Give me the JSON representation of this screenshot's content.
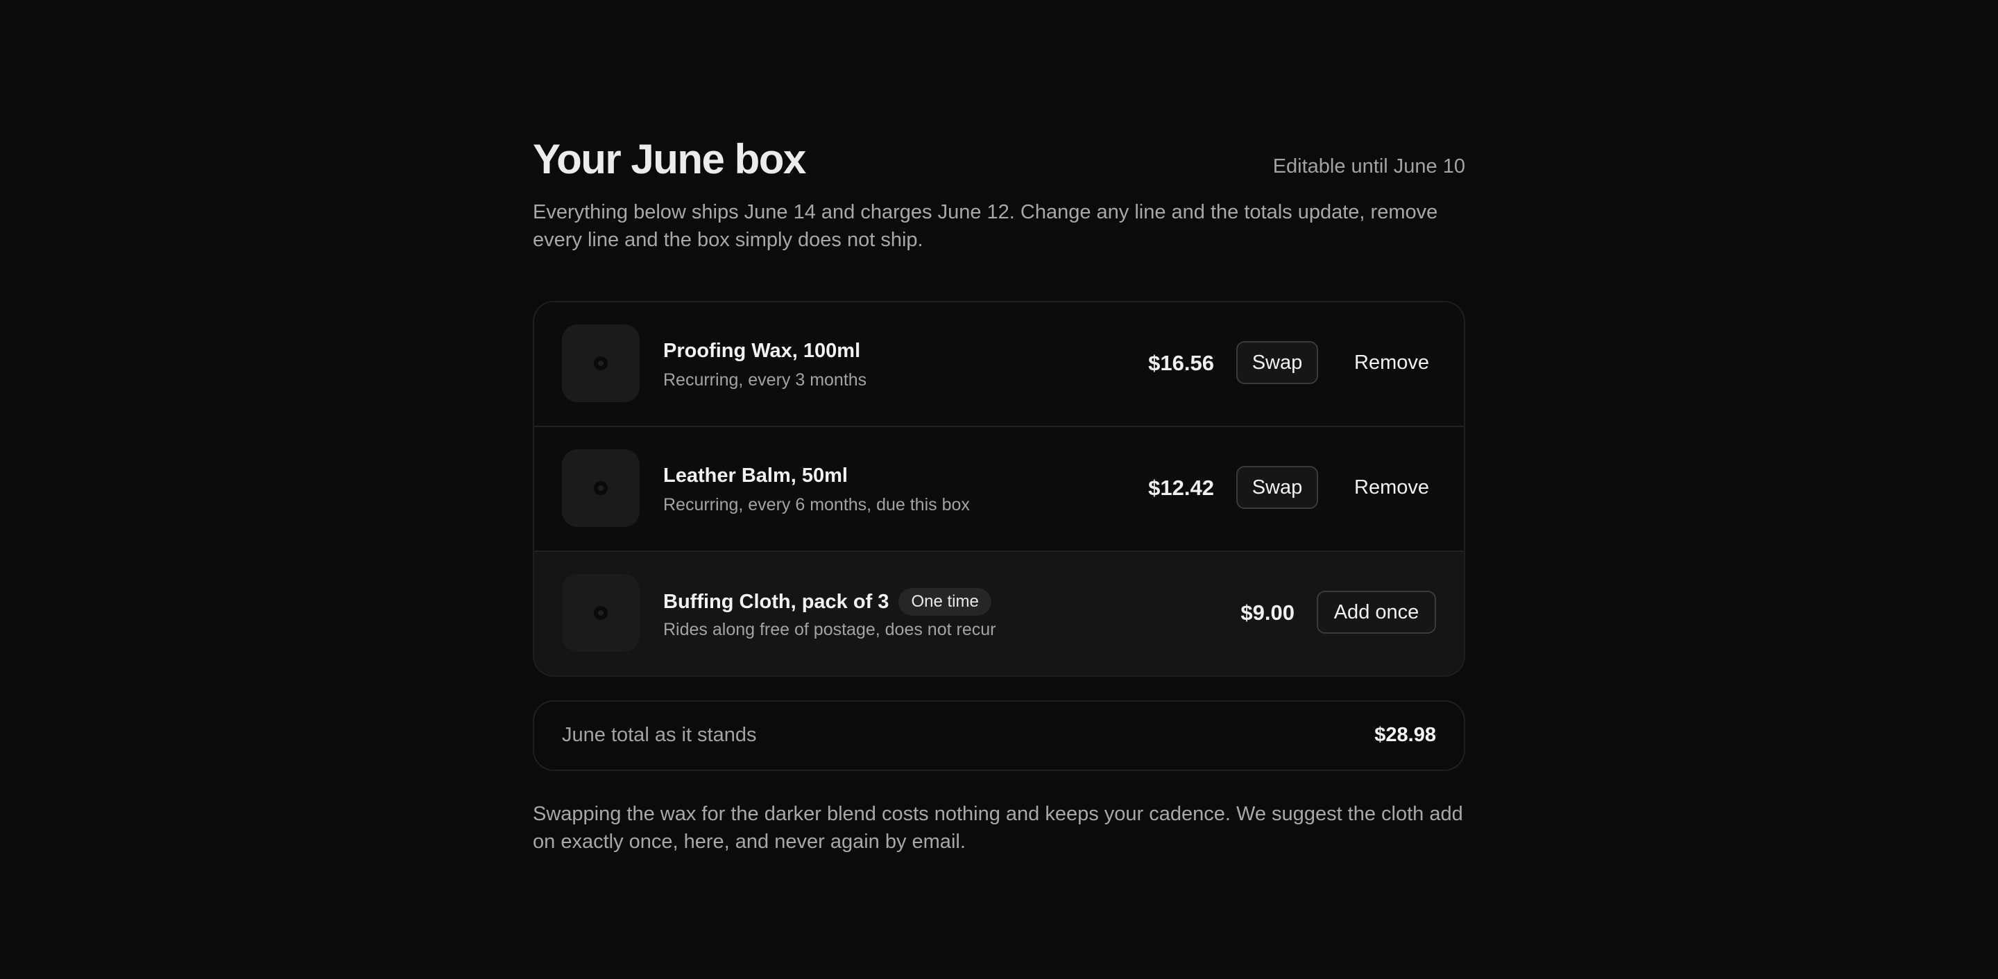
{
  "header": {
    "title": "Your June box",
    "editable_note": "Editable until June 10",
    "intro": "Everything below ships June 14 and charges June 12. Change any line and the totals update, remove every line and the box simply does not ship."
  },
  "items": [
    {
      "name": "Proofing Wax, 100ml",
      "subtitle": "Recurring, every 3 months",
      "price": "$16.56",
      "swap_label": "Swap",
      "remove_label": "Remove"
    },
    {
      "name": "Leather Balm, 50ml",
      "subtitle": "Recurring, every 6 months, due this box",
      "price": "$12.42",
      "swap_label": "Swap",
      "remove_label": "Remove"
    },
    {
      "name": "Buffing Cloth, pack of 3",
      "badge": "One time",
      "subtitle": "Rides along free of postage, does not recur",
      "price": "$9.00",
      "add_label": "Add once"
    }
  ],
  "totals": {
    "label": "June total as it stands",
    "value": "$28.98"
  },
  "footer": {
    "note": "Swapping the wax for the darker blend costs nothing and keeps your cadence. We suggest the cloth add on exactly once, here, and never again by email."
  },
  "colors": {
    "background": "#0b0b0b",
    "card": "#0c0c0c",
    "highlight_row": "#151515",
    "text_primary": "#f2f2f2",
    "text_muted": "#a3a3a3"
  }
}
